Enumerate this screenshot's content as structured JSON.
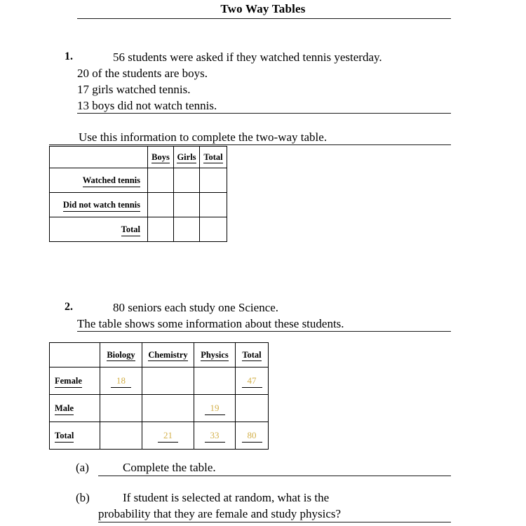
{
  "document": {
    "title": "Two Way Tables"
  },
  "questions": [
    {
      "number": "1.",
      "lines": [
        "56 students were asked if they watched tennis yesterday.",
        "20 of the students are boys.",
        "17 girls watched tennis.",
        "13 boys did not watch tennis."
      ],
      "instruction": "Use this information to complete the two-way table.",
      "table": {
        "column_headers": [
          "",
          "Boys",
          "Girls",
          "Total"
        ],
        "rows": [
          {
            "label": "Watched tennis",
            "values": [
              "",
              "",
              ""
            ]
          },
          {
            "label": "Did not watch tennis",
            "values": [
              "",
              "",
              ""
            ]
          },
          {
            "label": "Total",
            "values": [
              "",
              "",
              ""
            ]
          }
        ]
      }
    },
    {
      "number": "2.",
      "lines": [
        "80 seniors each study one Science.",
        "The table shows some information about these students."
      ],
      "table": {
        "column_headers": [
          "",
          "Biology",
          "Chemistry",
          "Physics",
          "Total"
        ],
        "rows": [
          {
            "label": "Female",
            "values": [
              "18",
              "",
              "",
              "47"
            ]
          },
          {
            "label": "Male",
            "values": [
              "",
              "",
              "19",
              ""
            ]
          },
          {
            "label": "Total",
            "values": [
              "",
              "21",
              "33",
              "80"
            ]
          }
        ]
      },
      "parts": [
        {
          "label": "(a)",
          "lines": [
            "Complete the table."
          ]
        },
        {
          "label": "(b)",
          "lines": [
            "If student is selected at random, what is the",
            "probability that they are female and study physics?"
          ]
        }
      ]
    }
  ],
  "colors": {
    "answer_text": "#d3b04a",
    "rule": "#1a1a1a",
    "text": "#000000"
  }
}
